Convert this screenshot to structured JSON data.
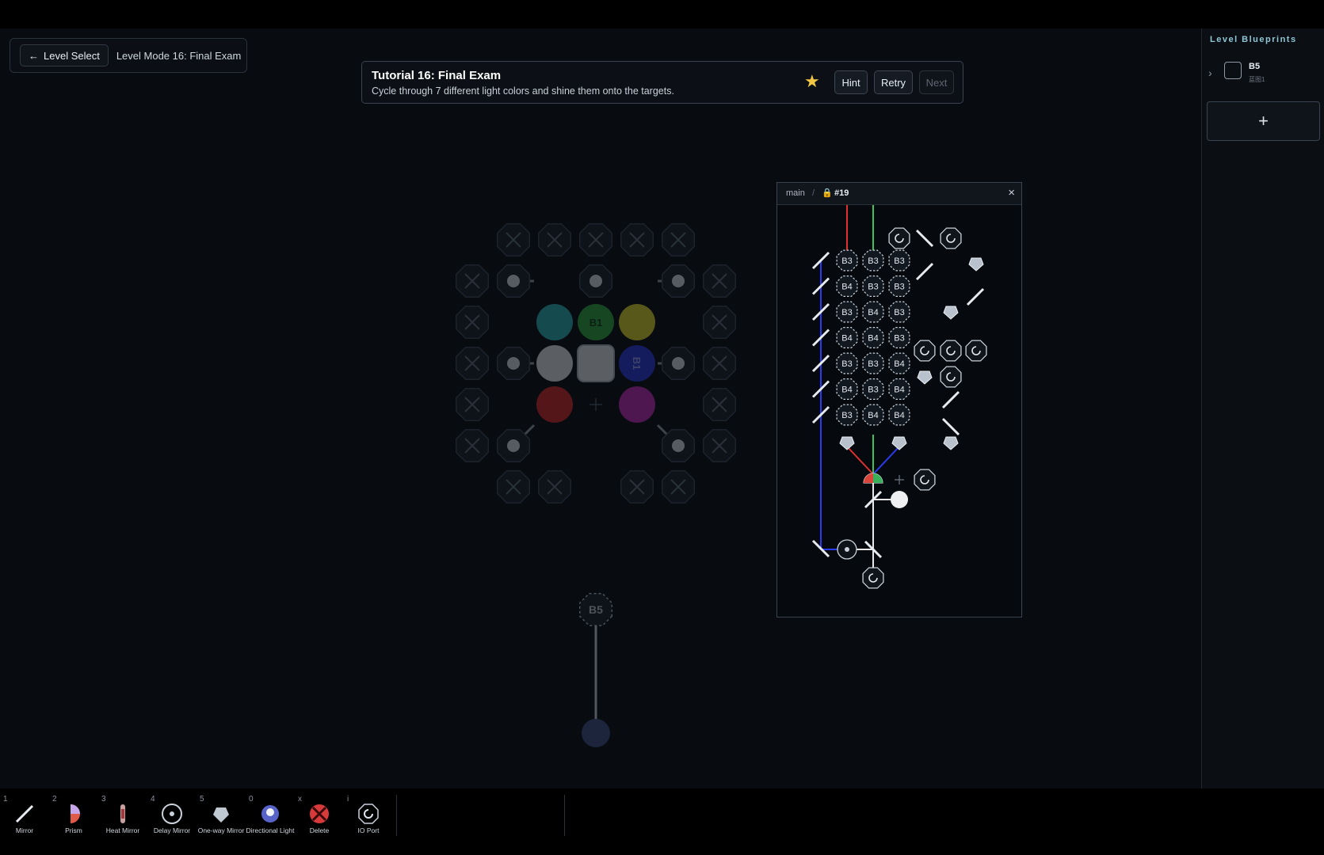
{
  "header": {
    "back_label": "Level Select",
    "level_title": "Level Mode 16: Final Exam"
  },
  "tutorial": {
    "title": "Tutorial 16: Final Exam",
    "description": "Cycle through 7 different light colors and shine them onto the targets.",
    "hint_label": "Hint",
    "retry_label": "Retry",
    "next_label": "Next"
  },
  "blueprints": {
    "title": "Level Blueprints",
    "items": [
      {
        "name": "B5",
        "sub": "蓝图1"
      }
    ],
    "add_label": "+"
  },
  "board": {
    "center_labels": [
      "B1",
      "B1"
    ],
    "blueprint_node_label": "B5"
  },
  "popup": {
    "breadcrumb_root": "main",
    "separator": "/",
    "lock_icon": "🔒",
    "id": "#19",
    "close_label": "×",
    "grid_rows": [
      [
        "B3",
        "B3",
        "B3"
      ],
      [
        "B4",
        "B3",
        "B3"
      ],
      [
        "B3",
        "B4",
        "B3"
      ],
      [
        "B4",
        "B4",
        "B3"
      ],
      [
        "B3",
        "B3",
        "B4"
      ],
      [
        "B4",
        "B3",
        "B4"
      ],
      [
        "B3",
        "B4",
        "B4"
      ]
    ]
  },
  "toolbar": {
    "tools": [
      {
        "key": "1",
        "label": "Mirror",
        "icon": "mirror-icon"
      },
      {
        "key": "2",
        "label": "Prism",
        "icon": "prism-icon"
      },
      {
        "key": "3",
        "label": "Heat Mirror",
        "icon": "heat-mirror-icon"
      },
      {
        "key": "4",
        "label": "Delay Mirror",
        "icon": "delay-mirror-icon"
      },
      {
        "key": "5",
        "label": "One-way Mirror",
        "icon": "one-way-mirror-icon"
      },
      {
        "key": "0",
        "label": "Directional Light",
        "icon": "directional-light-icon"
      },
      {
        "key": "x",
        "label": "Delete",
        "icon": "delete-icon"
      },
      {
        "key": "i",
        "label": "IO Port",
        "icon": "io-port-icon"
      }
    ]
  },
  "colors": {
    "accent": "#8fc6d4",
    "star": "#f3c744",
    "beam_red": "#e0312f",
    "beam_green": "#3fc25a",
    "beam_blue": "#2a3cf0",
    "beam_white": "#e8e8e8"
  }
}
